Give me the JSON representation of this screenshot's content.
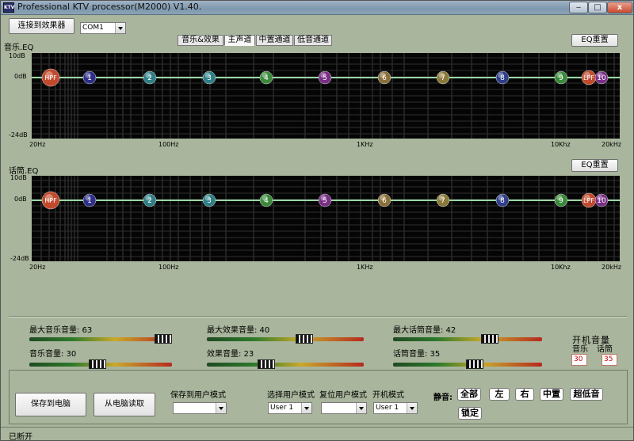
{
  "window": {
    "title": "Professional KTV processor(M2000) V1.40.",
    "icon_text": "KTV",
    "min_label": "‒",
    "max_label": "□",
    "close_label": "x"
  },
  "toolbar": {
    "connect_label": "连接到效果器",
    "port_value": "COM1"
  },
  "tabs": [
    {
      "label": "音乐&效果"
    },
    {
      "label": "主声道"
    },
    {
      "label": "中置通道"
    },
    {
      "label": "低音通道"
    }
  ],
  "music_eq": {
    "label": "音乐.EQ",
    "reset_label": "EQ重置",
    "y_labels": [
      "10dB",
      "0dB",
      "-24dB"
    ],
    "x_labels": [
      "20Hz",
      "100Hz",
      "1KHz",
      "10Khz",
      "20kHz"
    ],
    "nodes": [
      {
        "label": "HPF",
        "color": "#c24a2c"
      },
      {
        "label": "1",
        "color": "#2f2f8a"
      },
      {
        "label": "2",
        "color": "#2e7f86"
      },
      {
        "label": "3",
        "color": "#2e7f86"
      },
      {
        "label": "4",
        "color": "#3b8a3b"
      },
      {
        "label": "5",
        "color": "#7a2f86"
      },
      {
        "label": "6",
        "color": "#8a6f3a"
      },
      {
        "label": "7",
        "color": "#8a7a3a"
      },
      {
        "label": "8",
        "color": "#2f3f8a"
      },
      {
        "label": "9",
        "color": "#3b8a3b"
      },
      {
        "label": "LPF",
        "color": "#c24a2c"
      },
      {
        "label": "10",
        "color": "#7a2f86"
      }
    ]
  },
  "mic_eq": {
    "label": "话筒.EQ",
    "reset_label": "EQ重置",
    "y_labels": [
      "10dB",
      "0dB",
      "-24dB"
    ],
    "x_labels": [
      "20Hz",
      "100Hz",
      "1KHz",
      "10Khz",
      "20kHz"
    ],
    "nodes": [
      {
        "label": "HPF",
        "color": "#c24a2c"
      },
      {
        "label": "1",
        "color": "#2f2f8a"
      },
      {
        "label": "2",
        "color": "#2e7f86"
      },
      {
        "label": "3",
        "color": "#2e7f86"
      },
      {
        "label": "4",
        "color": "#3b8a3b"
      },
      {
        "label": "5",
        "color": "#7a2f86"
      },
      {
        "label": "6",
        "color": "#8a6f3a"
      },
      {
        "label": "7",
        "color": "#8a7a3a"
      },
      {
        "label": "8",
        "color": "#2f3f8a"
      },
      {
        "label": "9",
        "color": "#3b8a3b"
      },
      {
        "label": "LPF",
        "color": "#c24a2c"
      },
      {
        "label": "10",
        "color": "#7a2f86"
      }
    ]
  },
  "volumes": {
    "max_music": {
      "label": "最大音乐音量: 63",
      "value": 63
    },
    "music": {
      "label": "音乐音量: 30",
      "value": 30
    },
    "max_effect": {
      "label": "最大效果音量: 40",
      "value": 40
    },
    "effect": {
      "label": "效果音量: 23",
      "value": 23
    },
    "max_mic": {
      "label": "最大话筒音量: 42",
      "value": 42
    },
    "mic": {
      "label": "话筒音量: 35",
      "value": 35
    }
  },
  "startup_volume": {
    "title": "开机音量",
    "music_label": "音乐",
    "mic_label": "话筒",
    "music_value": "30",
    "mic_value": "35"
  },
  "bottom": {
    "save_pc_label": "保存到电脑",
    "load_pc_label": "从电脑读取",
    "save_user_label": "保存到用户模式",
    "save_user_value": "",
    "select_user_label": "选择用户模式",
    "select_user_value": "User 1",
    "reset_user_label": "复位用户模式",
    "reset_user_value": "",
    "startup_mode_label": "开机模式",
    "startup_mode_value": "User 1",
    "mute_label": "静音:",
    "mute_buttons": [
      "全部",
      "左",
      "右",
      "中置",
      "超低音",
      "锁定"
    ]
  },
  "status": {
    "text": "已断开"
  }
}
